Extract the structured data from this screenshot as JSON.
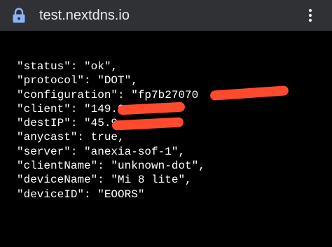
{
  "browser": {
    "url": "test.nextdns.io",
    "icons": {
      "lock": "lock-icon",
      "menu": "more-vertical-icon"
    },
    "colors": {
      "toolbar": "#303134",
      "lock": "#8ab4f8",
      "page_background": "#000000",
      "text": "#ffffff",
      "redaction": "#ff4a2e"
    }
  },
  "page": {
    "lines": [
      "\"status\": \"ok\",",
      "\"protocol\": \"DOT\",",
      "\"configuration\": \"fp7b27070",
      "\"client\": \"149.0",
      "\"destIP\": \"45.9",
      "\"anycast\": true,",
      "\"server\": \"anexia-sof-1\",",
      "\"clientName\": \"unknown-dot\",",
      "\"deviceName\": \"Mi 8 lite\",",
      "\"deviceID\": \"EOORS\""
    ]
  }
}
